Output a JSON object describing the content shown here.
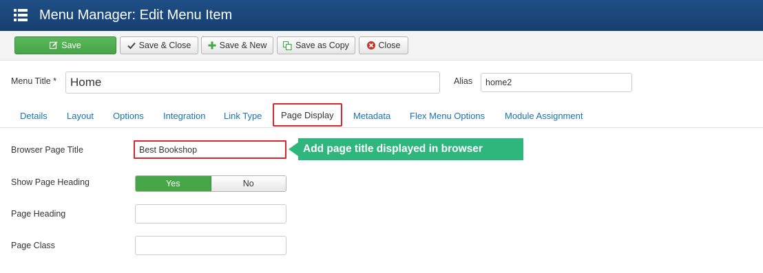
{
  "header": {
    "title": "Menu Manager: Edit Menu Item",
    "icon": "list-icon"
  },
  "toolbar": {
    "save": "Save",
    "save_close": "Save & Close",
    "save_new": "Save & New",
    "save_copy": "Save as Copy",
    "close": "Close"
  },
  "form": {
    "menu_title_label": "Menu Title *",
    "menu_title_value": "Home",
    "alias_label": "Alias",
    "alias_value": "home2"
  },
  "tabs": [
    "Details",
    "Layout",
    "Options",
    "Integration",
    "Link Type",
    "Page Display",
    "Metadata",
    "Flex Menu Options",
    "Module Assignment"
  ],
  "active_tab": "Page Display",
  "page_display": {
    "browser_title_label": "Browser Page Title",
    "browser_title_value": "Best Bookshop",
    "show_heading_label": "Show Page Heading",
    "yes": "Yes",
    "no": "No",
    "show_heading_selected": "Yes",
    "page_heading_label": "Page Heading",
    "page_heading_value": "",
    "page_class_label": "Page Class",
    "page_class_value": ""
  },
  "annotation": {
    "text": "Add page title displayed in browser",
    "color": "#2fb67c"
  },
  "colors": {
    "header": "#1b4679",
    "accent_green": "#46a546",
    "highlight_red": "#d9262c",
    "link": "#1a72ad"
  }
}
